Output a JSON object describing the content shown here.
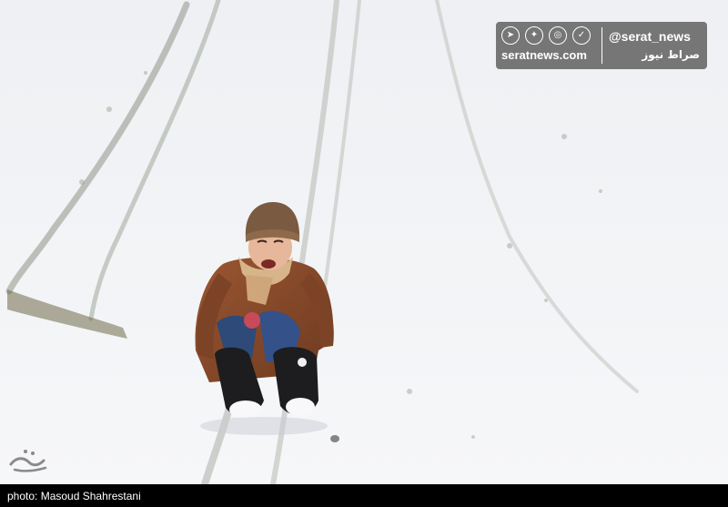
{
  "photo": {
    "subject": "person-sledding",
    "colors": {
      "snow": "#f2f3f5",
      "coat": "#8a4a2a",
      "hat": "#7a5a40",
      "jeans": "#2e4a78",
      "boots": "#1d1d1f"
    }
  },
  "watermark": {
    "handle": "@serat_news",
    "site": "seratnews.com",
    "site_fa": "صراط نیوز",
    "icons": [
      "telegram-icon",
      "twitter-icon",
      "instagram-icon",
      "messenger-icon"
    ]
  },
  "caption": {
    "text": "photo: Masoud Shahrestani"
  },
  "logo": {
    "icon": "agency-calligraphy-logo"
  }
}
